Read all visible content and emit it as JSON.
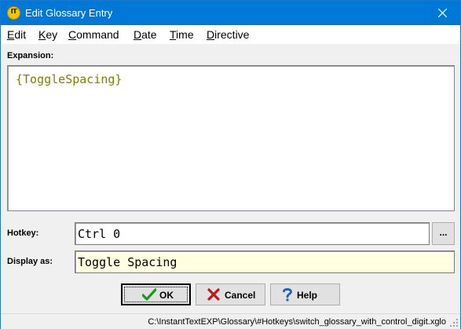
{
  "window": {
    "title": "Edit Glossary Entry",
    "app_icon_text": "IT"
  },
  "menu": [
    {
      "label": "Edit",
      "accel": "E",
      "rest": "dit"
    },
    {
      "label": "Key",
      "accel": "K",
      "rest": "ey"
    },
    {
      "label": "Command",
      "accel": "C",
      "rest": "ommand"
    },
    {
      "label": "Date",
      "accel": "D",
      "rest": "ate"
    },
    {
      "label": "Time",
      "accel": "T",
      "rest": "ime"
    },
    {
      "label": "Directive",
      "accel": "D",
      "rest": "irective"
    }
  ],
  "expansion": {
    "label": "Expansion:",
    "value": "{ToggleSpacing}",
    "text_color": "#808000"
  },
  "hotkey": {
    "label": "Hotkey:",
    "value": "Ctrl 0",
    "browse_label": "..."
  },
  "display_as": {
    "label": "Display as:",
    "value": "Toggle Spacing",
    "background": "#ffffe1"
  },
  "buttons": {
    "ok": {
      "label": "OK",
      "icon": "checkmark-icon"
    },
    "cancel": {
      "label": "Cancel",
      "icon": "x-icon"
    },
    "help": {
      "label": "Help",
      "icon": "question-icon"
    }
  },
  "status": {
    "path": "C:\\InstantTextEXP\\Glossary\\#Hotkeys\\switch_glossary_with_control_digit.xglo"
  },
  "colors": {
    "titlebar": "#0078d7",
    "window_bg": "#f0f0f0"
  }
}
